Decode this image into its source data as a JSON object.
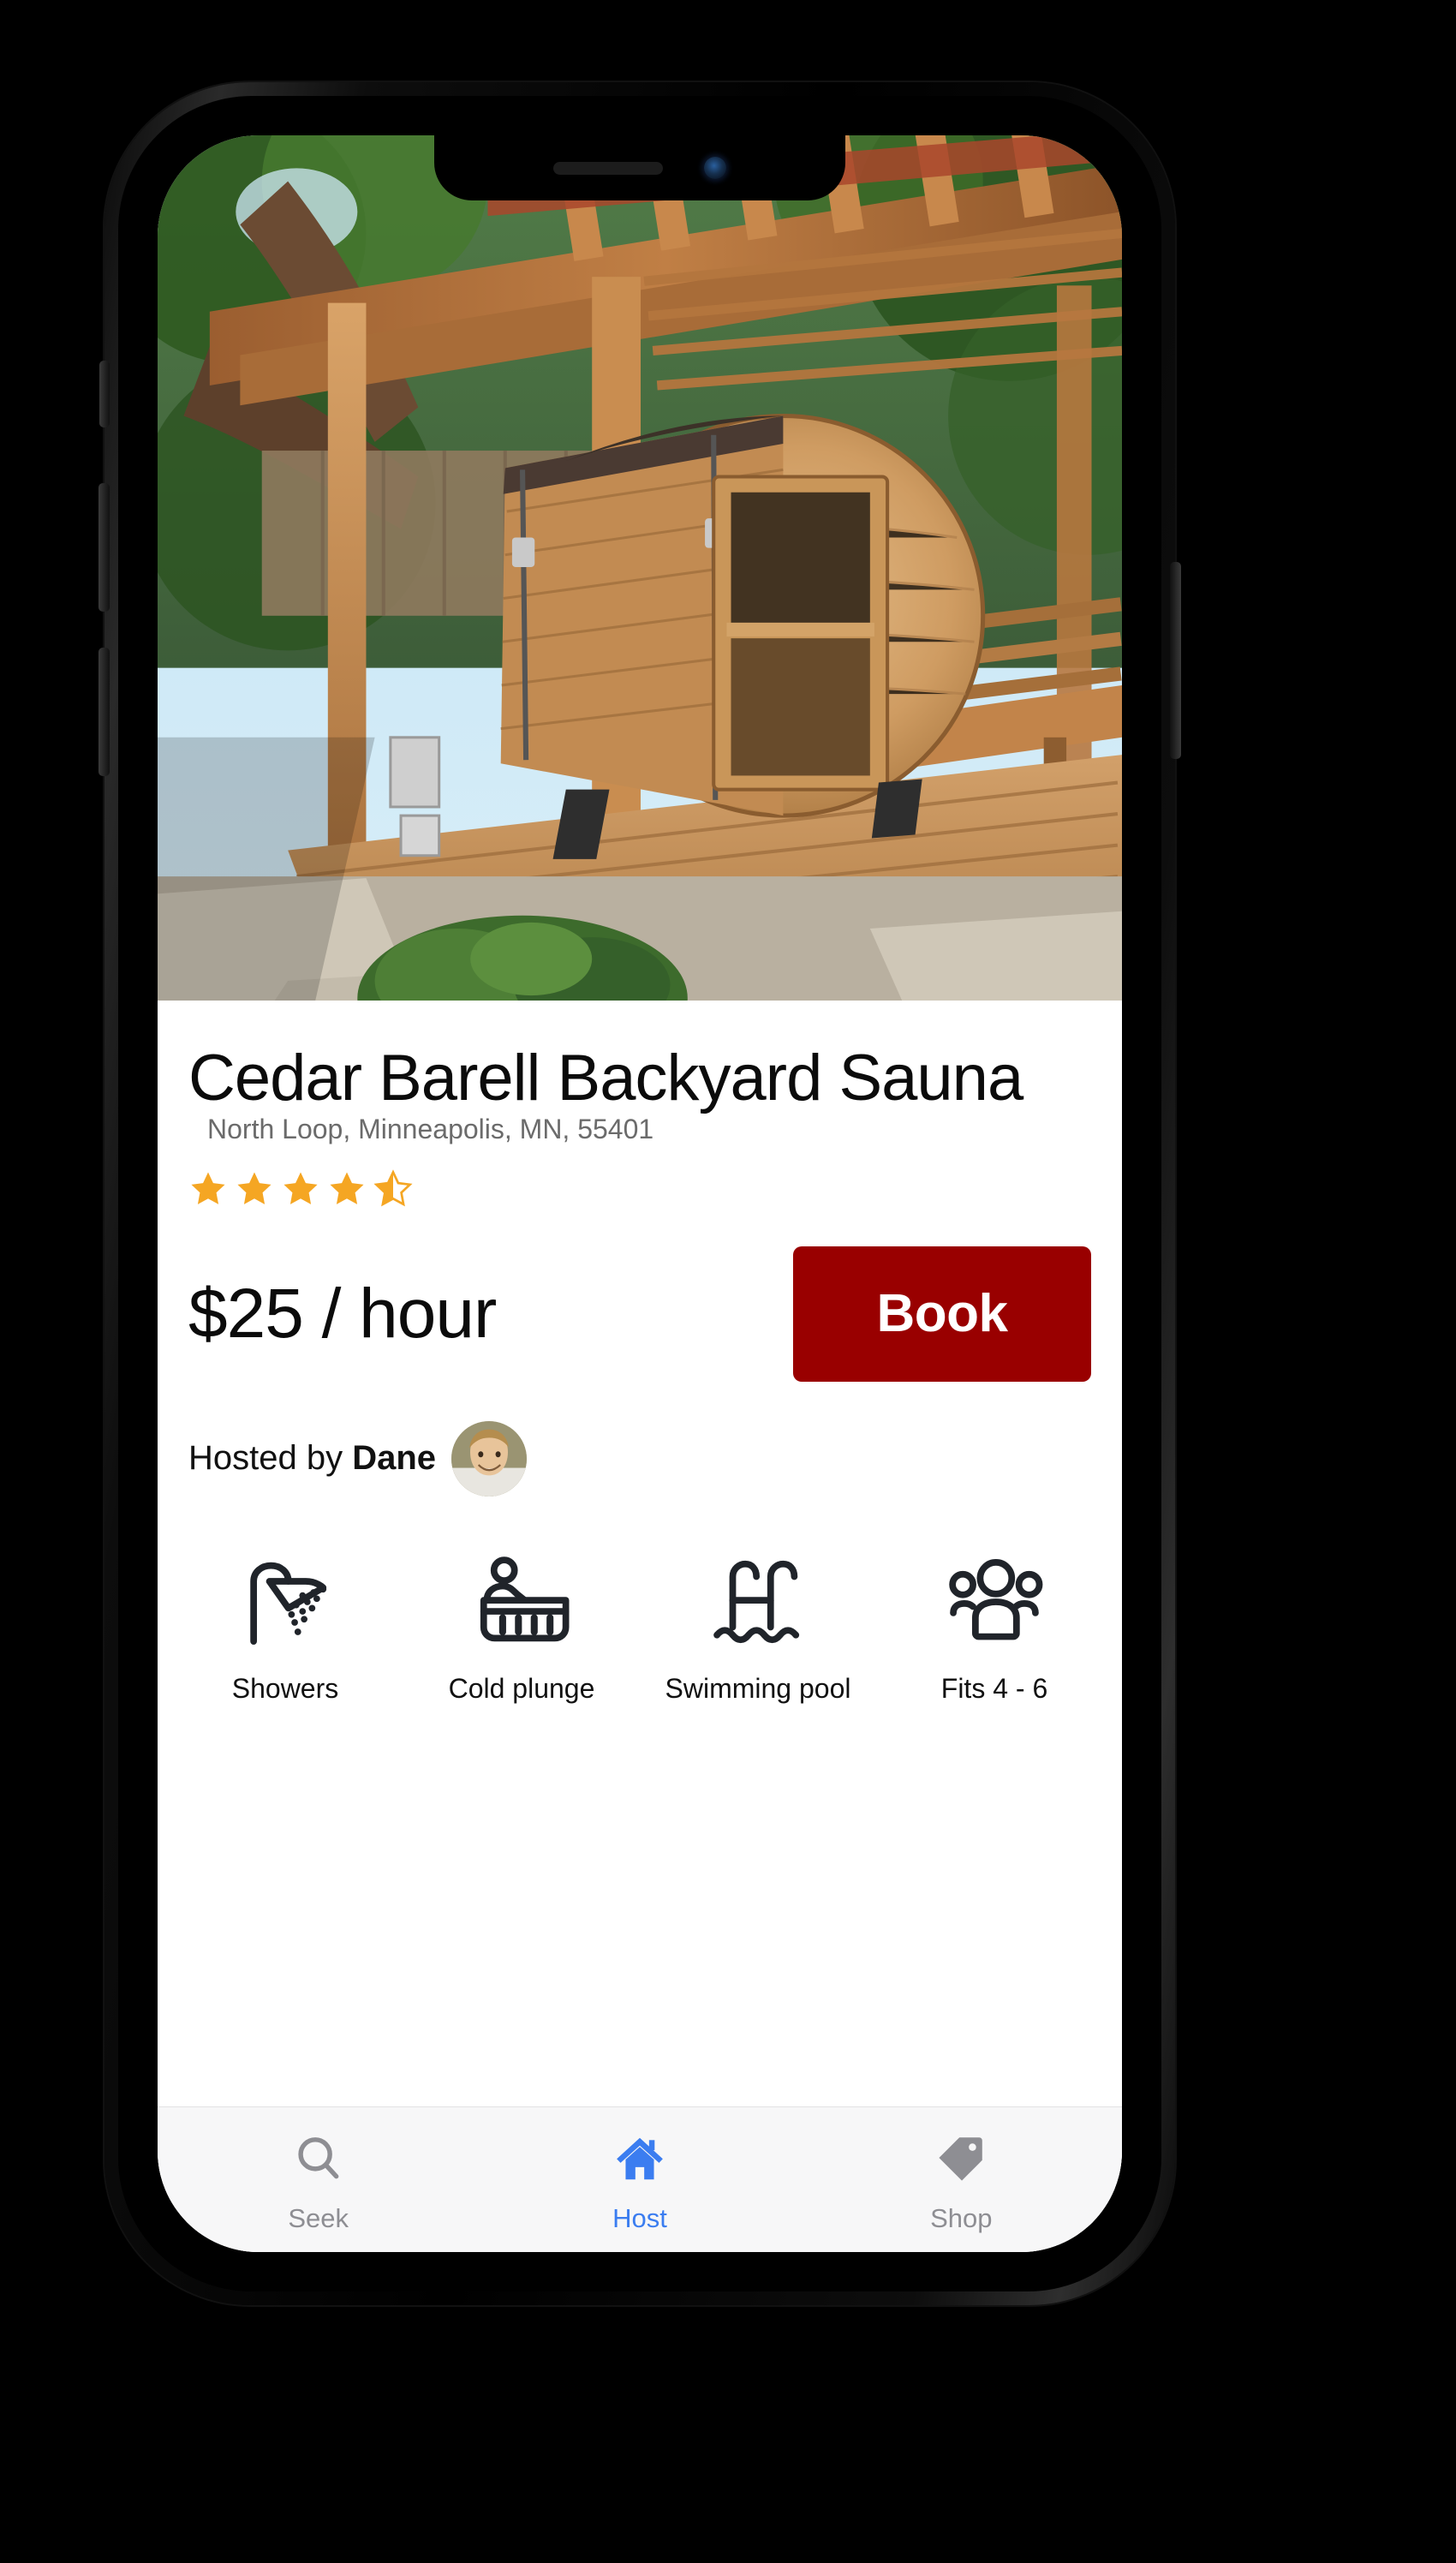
{
  "device": {
    "name": "iphone-x-mockup"
  },
  "hero": {
    "alt": "Cedar barrel sauna under wooden pergola in a backyard"
  },
  "listing": {
    "title": "Cedar Barell Backyard Sauna",
    "address": "North Loop, Minneapolis, MN, 55401",
    "rating": 4.5,
    "rating_max": 5,
    "price": "$25 / hour",
    "book_label": "Book",
    "host_prefix": "Hosted by ",
    "host_name": "Dane"
  },
  "amenities": [
    {
      "icon": "shower-icon",
      "label": "Showers"
    },
    {
      "icon": "cold-plunge-icon",
      "label": "Cold plunge"
    },
    {
      "icon": "swimming-pool-icon",
      "label": "Swimming pool"
    },
    {
      "icon": "people-group-icon",
      "label": "Fits 4 - 6"
    }
  ],
  "tabbar": {
    "items": [
      {
        "icon": "search-icon",
        "label": "Seek",
        "active": false
      },
      {
        "icon": "home-icon",
        "label": "Host",
        "active": true
      },
      {
        "icon": "tag-icon",
        "label": "Shop",
        "active": false
      }
    ]
  },
  "colors": {
    "accent_red": "#990000",
    "star_gold": "#F5A623",
    "tab_active_blue": "#3B7DF0",
    "tab_inactive_gray": "#8E8E93",
    "address_gray": "#6B6B6B",
    "icon_dark": "#20242A",
    "tabbar_bg": "#F7F7F8"
  }
}
